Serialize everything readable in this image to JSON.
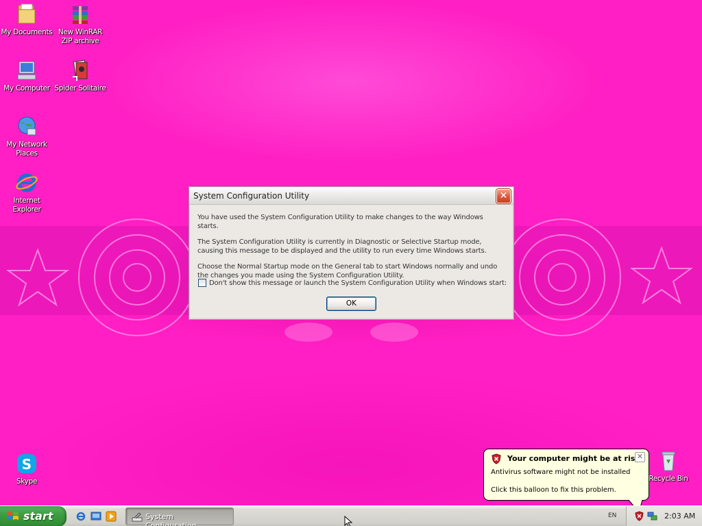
{
  "desktop": {
    "icons": [
      {
        "label": "My Documents"
      },
      {
        "label": "New WinRAR\nZIP archive"
      },
      {
        "label": "My Computer"
      },
      {
        "label": "Spider Solitaire"
      },
      {
        "label": "My Network\nPlaces"
      },
      {
        "label": "Internet\nExplorer"
      },
      {
        "label": "Skype"
      },
      {
        "label": "Recycle Bin"
      }
    ]
  },
  "dialog": {
    "title": "System Configuration Utility",
    "paragraphs": [
      "You have used the System Configuration Utility to make changes to the way Windows starts.",
      "The System Configuration Utility is currently in Diagnostic or Selective Startup mode, causing this message to be displayed and the utility to run every time Windows starts.",
      "Choose the Normal Startup mode on the General tab to start Windows normally and undo the changes you made using the System Configuration Utility."
    ],
    "checkbox_label": "Don't show this message or launch the System Configuration Utility when Windows start:",
    "checkbox_checked": false,
    "ok_label": "OK"
  },
  "balloon": {
    "title": "Your computer might be at risk",
    "line1": "Antivirus software might not be installed",
    "line2": "Click this balloon to fix this problem."
  },
  "taskbar": {
    "start_label": "start",
    "quick_launch": [
      "internet-explorer-icon",
      "show-desktop-icon",
      "media-player-icon"
    ],
    "task_button_label": "System Configuration...",
    "language": "EN",
    "clock": "2:03 AM"
  },
  "colors": {
    "wallpaper": "#ff1fc4",
    "start_green": "#3c9c40",
    "balloon_bg": "#ffffe1",
    "dialog_bg": "#ece9e4"
  }
}
